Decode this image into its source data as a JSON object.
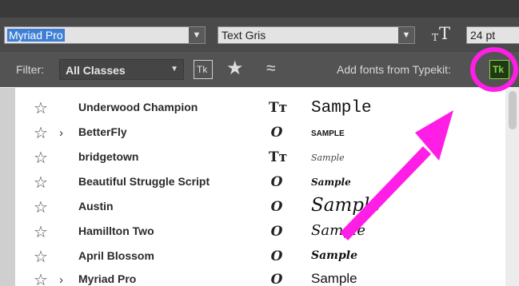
{
  "toolbar": {
    "font_family": "Myriad Pro",
    "font_style": "Text Gris",
    "font_size": "24 pt"
  },
  "filter": {
    "label": "Filter:",
    "class_value": "All Classes",
    "typekit_filter": "Tk",
    "add_fonts_label": "Add fonts from Typekit:",
    "typekit_button": "Tk"
  },
  "fonts": [
    {
      "name": "Underwood Champion",
      "has_family": false,
      "type": "truetype",
      "sample": "Sample"
    },
    {
      "name": "BetterFly",
      "has_family": true,
      "type": "opentype",
      "sample": "SAMPLE"
    },
    {
      "name": "bridgetown",
      "has_family": false,
      "type": "truetype",
      "sample": "Sample"
    },
    {
      "name": "Beautiful Struggle Script",
      "has_family": false,
      "type": "opentype",
      "sample": "Sample"
    },
    {
      "name": "Austin",
      "has_family": false,
      "type": "opentype",
      "sample": "Sample"
    },
    {
      "name": "Hamillton Two",
      "has_family": false,
      "type": "opentype",
      "sample": "Sample"
    },
    {
      "name": "April Blossom",
      "has_family": false,
      "type": "opentype",
      "sample": "Sample"
    },
    {
      "name": "Myriad Pro",
      "has_family": true,
      "type": "opentype",
      "sample": "Sample"
    }
  ],
  "colors": {
    "highlight_ring": "#ff1ee6",
    "arrow": "#ff1ee6",
    "typekit_green": "#8bd04a",
    "selection_blue": "#3d7fd6"
  },
  "icons": {
    "star": "star-outline-icon",
    "chevron": "chevron-right-icon",
    "truetype": "truetype-icon",
    "opentype": "opentype-icon",
    "favorites": "star-filled-icon",
    "similar": "similar-approx-icon"
  }
}
